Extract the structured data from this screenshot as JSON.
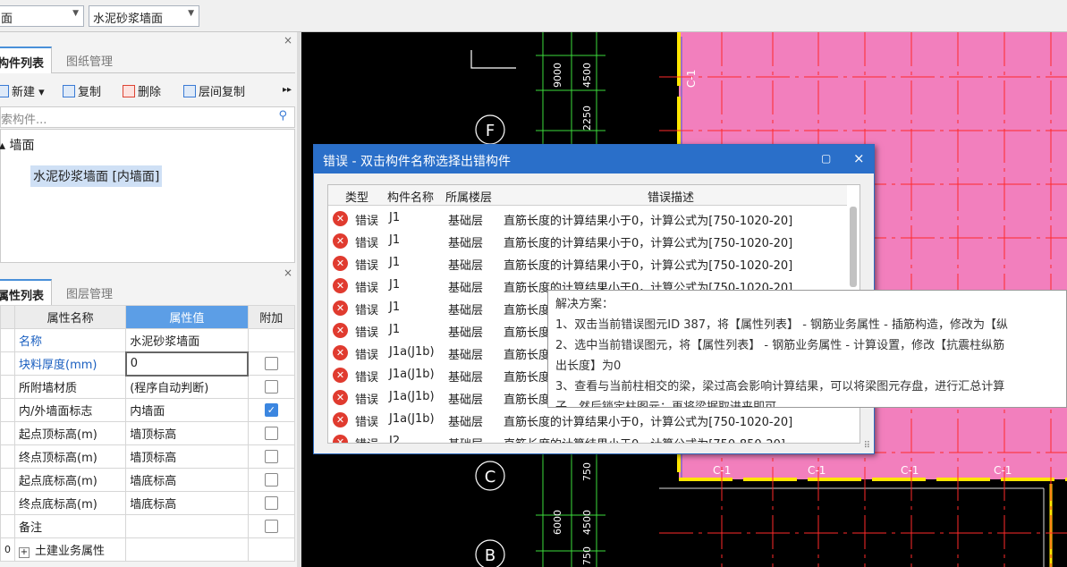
{
  "top": {
    "combo1": "面",
    "combo2": "水泥砂浆墙面"
  },
  "panel1": {
    "tabs": [
      "构件列表",
      "图纸管理"
    ],
    "toolbar": [
      "新建",
      "复制",
      "删除",
      "层间复制"
    ],
    "more": "▸▸",
    "search_placeholder": "索构件...",
    "tree_root": "墙面",
    "tree_item": "水泥砂浆墙面 [内墙面]"
  },
  "panel2": {
    "tabs": [
      "属性列表",
      "图层管理"
    ],
    "headers": [
      "属性名称",
      "属性值",
      "附加"
    ],
    "rows": [
      {
        "num": "",
        "name": "名称",
        "value": "水泥砂浆墙面",
        "checked": false,
        "nobox": true
      },
      {
        "num": "",
        "name": "块料厚度(mm)",
        "value": "0",
        "checked": false
      },
      {
        "num": "",
        "name": "所附墙材质",
        "value": "(程序自动判断)",
        "checked": false
      },
      {
        "num": "",
        "name": "内/外墙面标志",
        "value": "内墙面",
        "checked": true
      },
      {
        "num": "",
        "name": "起点顶标高(m)",
        "value": "墙顶标高",
        "checked": false
      },
      {
        "num": "",
        "name": "终点顶标高(m)",
        "value": "墙顶标高",
        "checked": false
      },
      {
        "num": "",
        "name": "起点底标高(m)",
        "value": "墙底标高",
        "checked": false
      },
      {
        "num": "",
        "name": "终点底标高(m)",
        "value": "墙底标高",
        "checked": false
      },
      {
        "num": "",
        "name": "备注",
        "value": "",
        "checked": false
      },
      {
        "num": "0",
        "name": "土建业务属性",
        "value": "",
        "checked": false,
        "nobox": true,
        "expand": true
      }
    ]
  },
  "cad": {
    "axes": [
      "F",
      "C",
      "B"
    ],
    "dims_top": [
      "9000",
      "4500",
      "2250"
    ],
    "dims_bottom": [
      "6000",
      "4500",
      "750",
      "750"
    ],
    "beam_labels": [
      "C-1",
      "C-1",
      "C-1",
      "C-1",
      "C-1"
    ],
    "color_slab": "#f27fbd",
    "color_grid": "#ff2a2a",
    "color_wall": "#ffe600"
  },
  "dialog": {
    "title": "错误 - 双击构件名称选择出错构件",
    "headers": [
      "类型",
      "构件名称",
      "所属楼层",
      "错误描述"
    ],
    "rows": [
      {
        "type": "错误",
        "name": "J1",
        "floor": "基础层",
        "desc": "直筋长度的计算结果小于0，计算公式为[750-1020-20]"
      },
      {
        "type": "错误",
        "name": "J1",
        "floor": "基础层",
        "desc": "直筋长度的计算结果小于0，计算公式为[750-1020-20]"
      },
      {
        "type": "错误",
        "name": "J1",
        "floor": "基础层",
        "desc": "直筋长度的计算结果小于0，计算公式为[750-1020-20]"
      },
      {
        "type": "错误",
        "name": "J1",
        "floor": "基础层",
        "desc": "直筋长度的计算结果小于0，计算公式为[750-1020-20]"
      },
      {
        "type": "错误",
        "name": "J1",
        "floor": "基础层",
        "desc": "直筋长度的计算结果小于0，计算公式为[750-1020-20]"
      },
      {
        "type": "错误",
        "name": "J1",
        "floor": "基础层",
        "desc": "直筋长度的计算结果小于0，计算公式为[750-1020-20]"
      },
      {
        "type": "错误",
        "name": "J1a(J1b)",
        "floor": "基础层",
        "desc": "直筋长度的计算结果小于0，计算公式为[750-1020-20]"
      },
      {
        "type": "错误",
        "name": "J1a(J1b)",
        "floor": "基础层",
        "desc": "直筋长度的计算结果小于0，计算公式为[750-1020-20]"
      },
      {
        "type": "错误",
        "name": "J1a(J1b)",
        "floor": "基础层",
        "desc": "直筋长度的计算结果小于0，计算公式为[750-1020-20]"
      },
      {
        "type": "错误",
        "name": "J1a(J1b)",
        "floor": "基础层",
        "desc": "直筋长度的计算结果小于0，计算公式为[750-1020-20]"
      },
      {
        "type": "错误",
        "name": "J2",
        "floor": "基础层",
        "desc": "直筋长度的计算结果小于0，计算公式为[750-850-20]"
      }
    ]
  },
  "tooltip": {
    "lines": [
      "解决方案：",
      "1、双击当前错误图元ID 387，将【属性列表】 - 钢筋业务属性 - 插筋构造，修改为【纵",
      "2、选中当前错误图元，将【属性列表】 - 钢筋业务属性 - 计算设置，修改【抗震柱纵筋",
      "出长度】为0",
      "3、查看与当前柱相交的梁，梁过高会影响计算结果，可以将梁图元存盘，进行汇总计算",
      "子，然后锁定柱图元；再将梁据取进来即可"
    ]
  }
}
